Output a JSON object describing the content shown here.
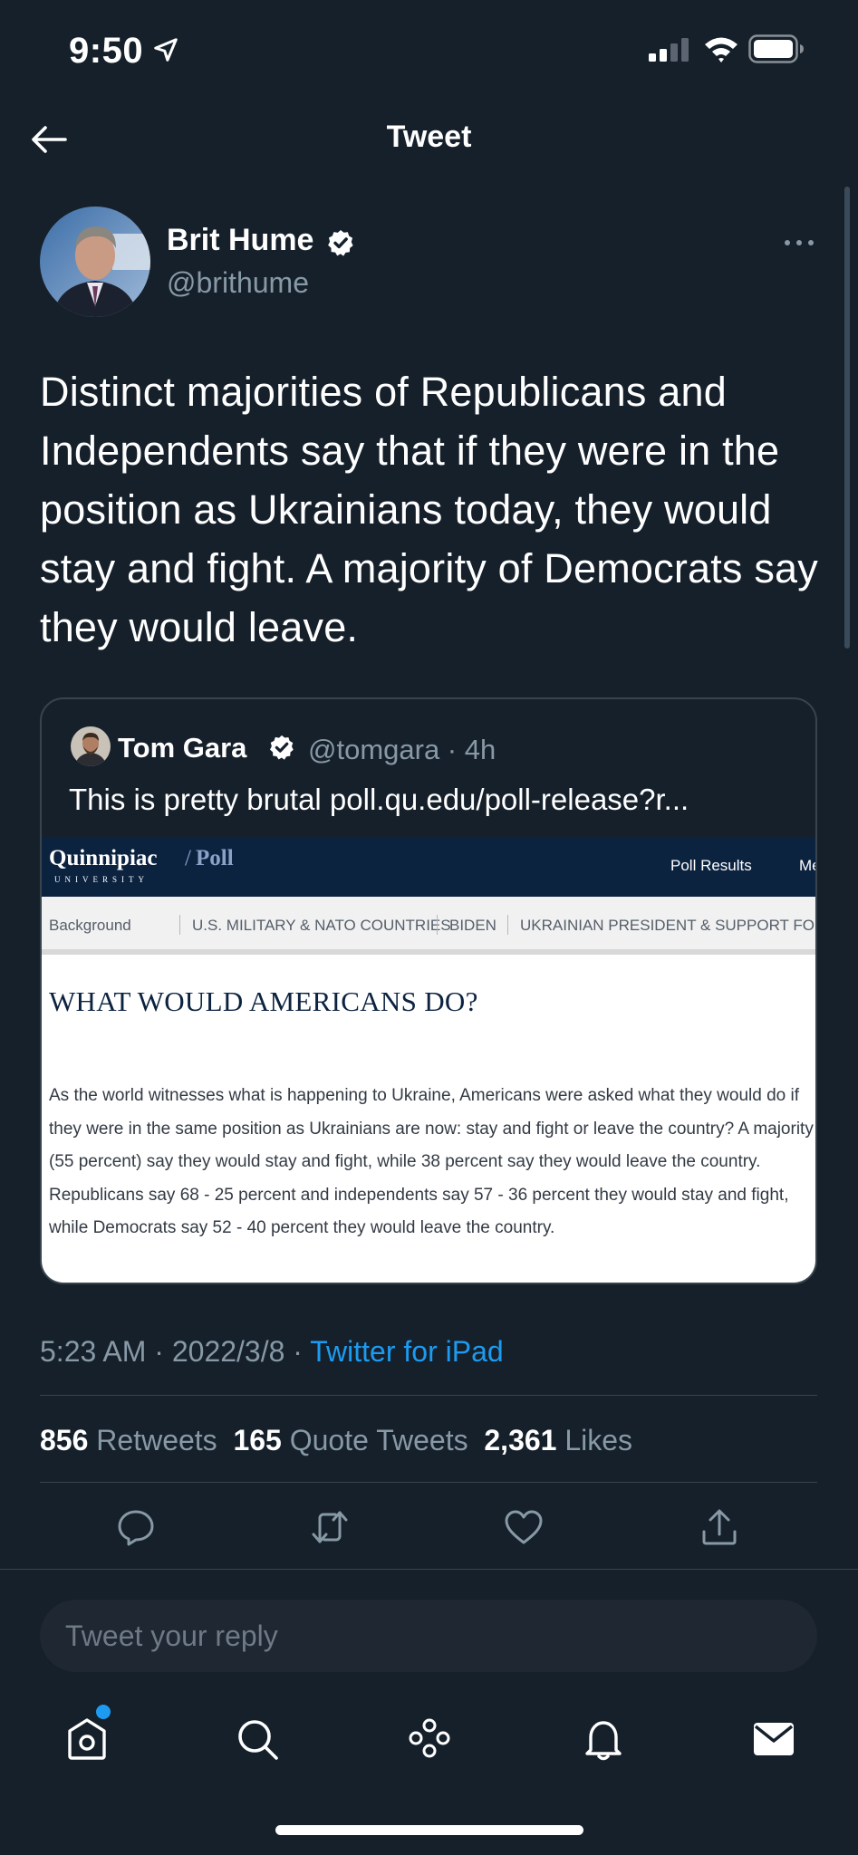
{
  "status_bar": {
    "time": "9:50"
  },
  "header": {
    "title": "Tweet"
  },
  "author": {
    "name": "Brit Hume",
    "handle": "@brithume"
  },
  "tweet": {
    "text": "Distinct majorities of Republicans and Independents say that if they were in the position as Ukrainians today, they would stay and fight. A majority of Democrats say they would leave."
  },
  "quote": {
    "name": "Tom Gara",
    "handle": "@tomgara · 4h",
    "text": "This is pretty brutal poll.qu.edu/poll-release?r...",
    "image": {
      "logo_main": "Quinnipiac",
      "logo_sep": "/",
      "logo_poll": "Poll",
      "logo_sub": "UNIVERSITY",
      "nav_results": "Poll Results",
      "nav_more": "Me",
      "tabs": [
        "Background",
        "U.S. MILITARY & NATO COUNTRIES",
        "BIDEN",
        "UKRAINIAN PRESIDENT & SUPPORT FO"
      ],
      "heading": "WHAT WOULD AMERICANS DO?",
      "body": "As the world witnesses what is happening to Ukraine, Americans were asked what they would do if they were in the same position as Ukrainians are now: stay and fight or leave the country? A majority (55 percent) say they would stay and fight, while 38 percent say they would leave the country. Republicans say 68 - 25 percent and independents say 57 - 36 percent they would stay and fight, while Democrats say 52 - 40 percent they would leave the country."
    }
  },
  "meta": {
    "time_date": "5:23 AM · 2022/3/8 · ",
    "source": "Twitter for iPad"
  },
  "stats": {
    "retweets": "856",
    "retweets_label": "Retweets",
    "quotes": "165",
    "quotes_label": "Quote Tweets",
    "likes": "2,361",
    "likes_label": "Likes"
  },
  "reply": {
    "placeholder": "Tweet your reply"
  },
  "colors": {
    "background": "#15202b",
    "accent": "#1d9bf0",
    "muted": "#8899a6",
    "border": "#38444d"
  },
  "icons": {
    "actions": [
      "reply-icon",
      "retweet-icon",
      "like-icon",
      "share-icon"
    ],
    "tab_bar": [
      "home-icon",
      "search-icon",
      "spaces-icon",
      "notifications-icon",
      "messages-icon"
    ]
  }
}
